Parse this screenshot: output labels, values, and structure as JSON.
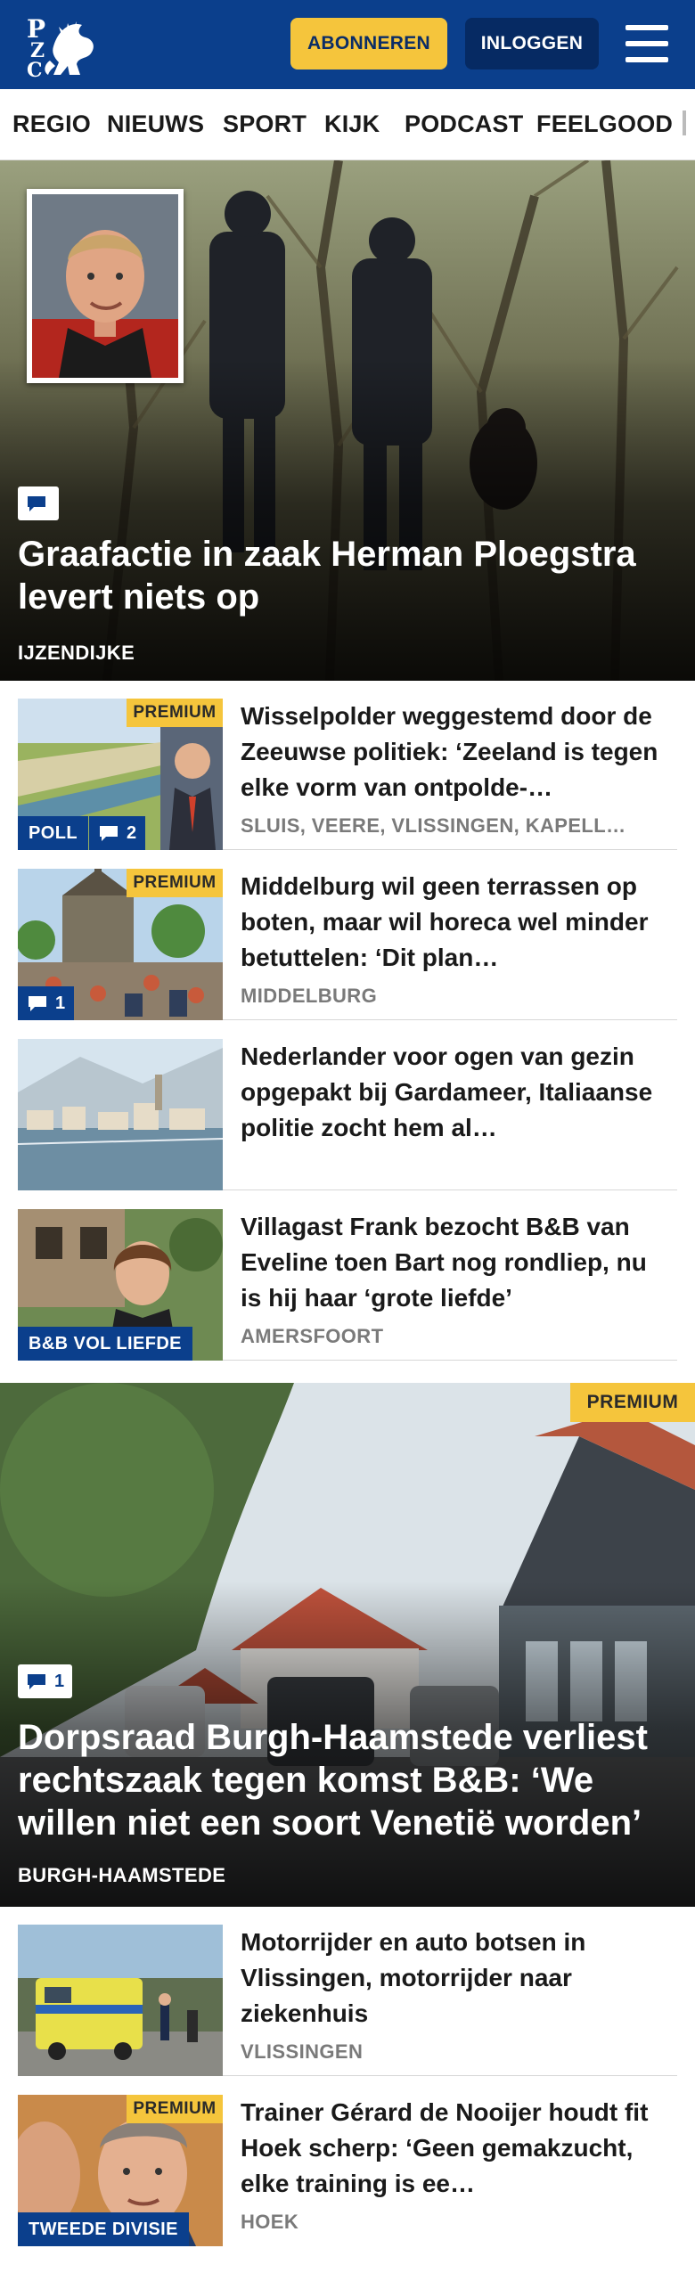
{
  "header": {
    "logo_text": "PZC",
    "subscribe_label": "ABONNEREN",
    "login_label": "INLOGGEN",
    "brand_color": "#0b3f8c",
    "accent_color": "#f5c53c"
  },
  "nav": {
    "items": [
      "REGIO",
      "NIEUWS",
      "SPORT",
      "KIJK",
      "PODCAST",
      "FEELGOOD"
    ]
  },
  "hero1": {
    "title": "Graafactie in zaak Herman Ploegstra levert niets op",
    "location": "IJZENDIJKE",
    "icon": "comment-icon"
  },
  "articles1": [
    {
      "title": "Wisselpolder weggestemd door de Zeeuwse politiek: ‘Zeeland is tegen elke vorm van ontpolde-…",
      "location": "SLUIS, VEERE, VLISSINGEN, KAPELL…",
      "premium": "PREMIUM",
      "tag": "POLL",
      "comments": "2"
    },
    {
      "title": "Middelburg wil geen terrassen op boten, maar wil horeca wel minder betuttelen: ‘Dit plan…",
      "location": "MIDDELBURG",
      "premium": "PREMIUM",
      "comments": "1"
    },
    {
      "title": "Nederlander voor ogen van gezin opgepakt bij Gardameer, Italiaanse politie zocht hem al…",
      "location": ""
    },
    {
      "title": "Villagast Frank bezocht B&B van Eveline toen Bart nog rondliep, nu is hij haar ‘grote liefde’",
      "location": "AMERSFOORT",
      "tag": "B&B VOL LIEFDE"
    }
  ],
  "hero2": {
    "premium": "PREMIUM",
    "comments": "1",
    "title": "Dorpsraad Burgh-Haamstede verliest rechtszaak tegen komst B&B: ‘We willen niet een soort Venetië worden’",
    "location": "BURGH-HAAMSTEDE"
  },
  "articles2": [
    {
      "title": "Motorrijder en auto botsen in Vlissingen, motorrijder naar ziekenhuis",
      "location": "VLISSINGEN"
    },
    {
      "title": "Trainer Gérard de Nooijer houdt fit Hoek scherp: ‘Geen gemakzucht, elke training is ee…",
      "location": "HOEK",
      "premium": "PREMIUM",
      "tag": "TWEEDE DIVISIE"
    }
  ]
}
